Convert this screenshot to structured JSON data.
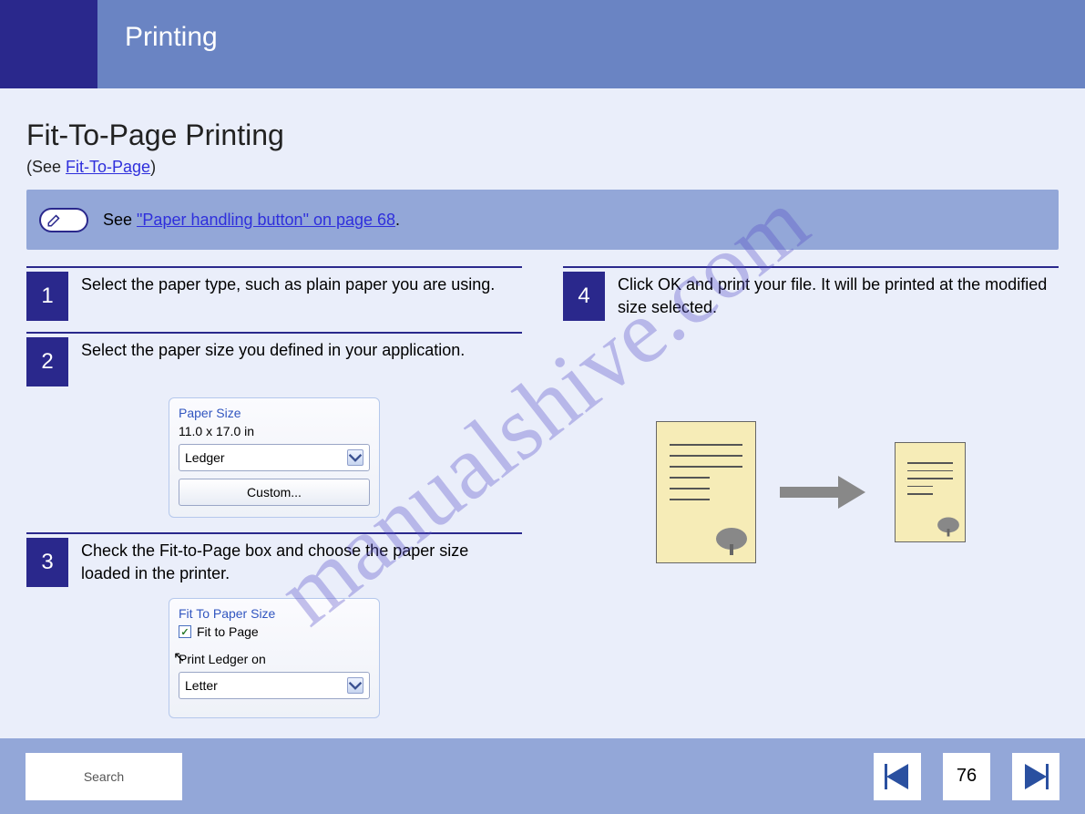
{
  "header": {
    "title": "Printing"
  },
  "title": "Fit-To-Page Printing",
  "subtitle_prefix": "(See ",
  "subtitle_link": "Fit-To-Page",
  "subtitle_suffix": ")",
  "note": {
    "prefix": "See ",
    "link": "\"Paper handling button\" on page 68",
    "suffix": "."
  },
  "steps": {
    "s1": "Select the paper type, such as plain paper you are using.",
    "s2": "Select the paper size you defined in your application.",
    "s3": "Check the Fit-to-Page box and choose the paper size loaded in the printer.",
    "s4": "Click OK and print your file. It will be printed at the modified size selected."
  },
  "paper_widget": {
    "title": "Paper Size",
    "value_text": "11.0 x 17.0 in",
    "selected": "Ledger",
    "custom_btn": "Custom..."
  },
  "fit_widget": {
    "title": "Fit To Paper Size",
    "chk_label": "Fit to Page",
    "desc": "Print Ledger on",
    "selected": "Letter"
  },
  "footer": {
    "search": "Search",
    "page": "76"
  },
  "watermark": "manualshive.com"
}
